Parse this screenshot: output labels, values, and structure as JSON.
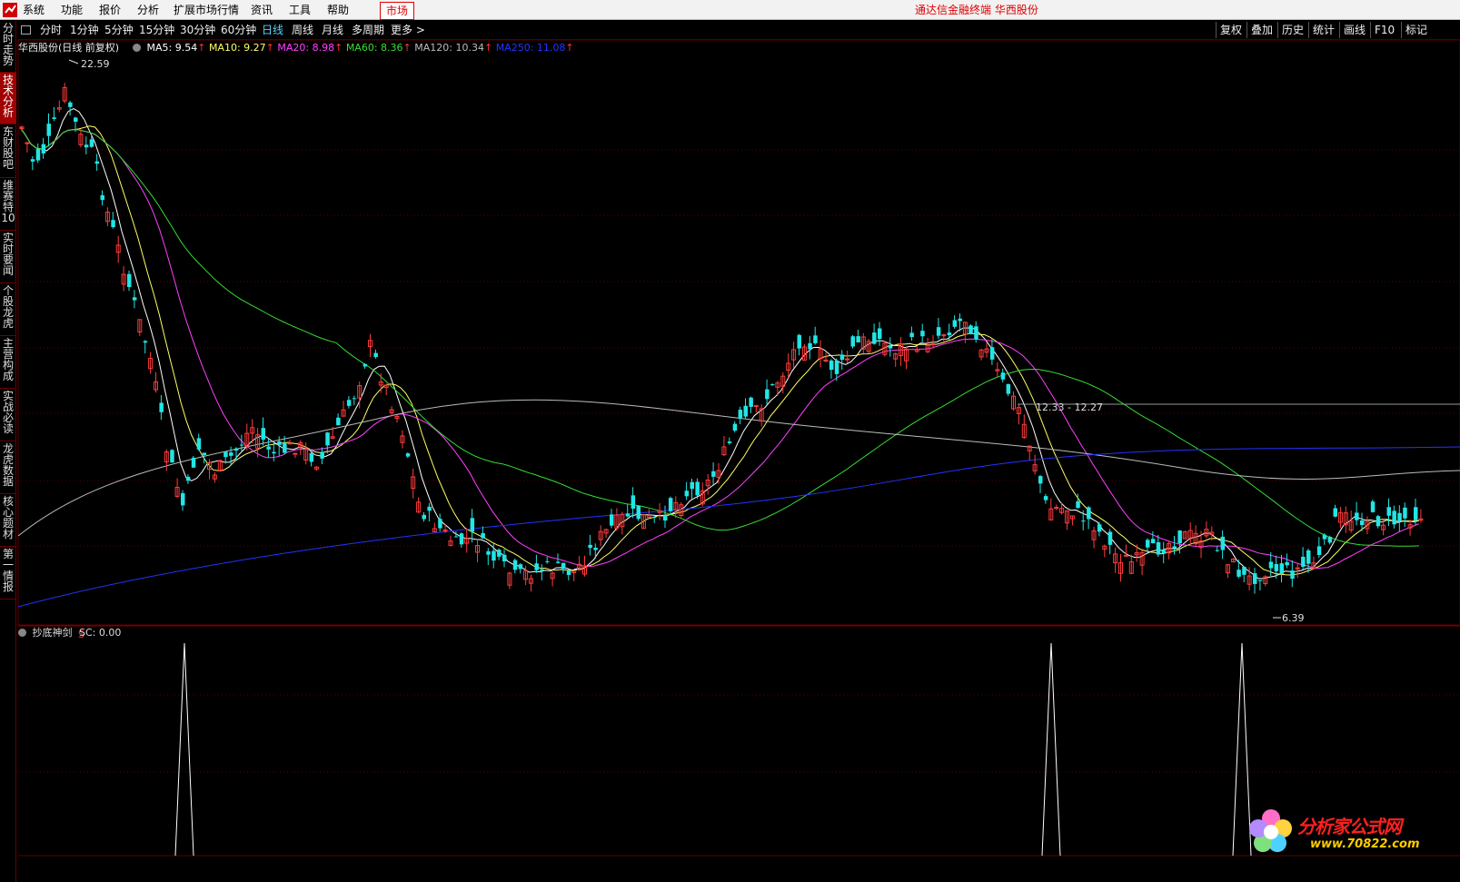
{
  "menu": {
    "items": [
      "系统",
      "功能",
      "报价",
      "分析",
      "扩展市场行情",
      "资讯",
      "工具",
      "帮助"
    ],
    "market_tab": "市场",
    "terminal_title": "通达信金融终端  华西股份"
  },
  "toolbar": {
    "periods": [
      "分时",
      "1分钟",
      "5分钟",
      "15分钟",
      "30分钟",
      "60分钟",
      "日线",
      "周线",
      "月线",
      "多周期",
      "更多 >"
    ],
    "active_period": "日线",
    "right_buttons": [
      "复权",
      "叠加",
      "历史",
      "统计",
      "画线",
      "F10",
      "标记"
    ]
  },
  "sidebar": {
    "tabs": [
      "分时走势",
      "技术分析",
      "东财股吧",
      "维赛特10",
      "实时要闻",
      "个股龙虎",
      "主营构成",
      "实战必读",
      "龙虎数据",
      "核心题材",
      "第一情报"
    ],
    "active": "技术分析"
  },
  "main_chart": {
    "stock_label": "华西股份(日线 前复权)",
    "ma": [
      {
        "label": "MA5: 9.54",
        "color": "#ffffff"
      },
      {
        "label": "MA10: 9.27",
        "color": "#ffff66"
      },
      {
        "label": "MA20: 8.98",
        "color": "#ff40ff"
      },
      {
        "label": "MA60: 8.36",
        "color": "#33dd33"
      },
      {
        "label": "MA120: 10.34",
        "color": "#bbbbbb"
      },
      {
        "label": "MA250: 11.08",
        "color": "#2233ff"
      }
    ],
    "high_label": "22.59",
    "low_label": "6.39",
    "range_label": "12.33 - 12.27",
    "s_marker": "S"
  },
  "indicator": {
    "name": "抄底神剑",
    "value_label": "SC: 0.00"
  },
  "watermark": {
    "text": "分析家公式网",
    "url": "www.70822.com"
  }
}
